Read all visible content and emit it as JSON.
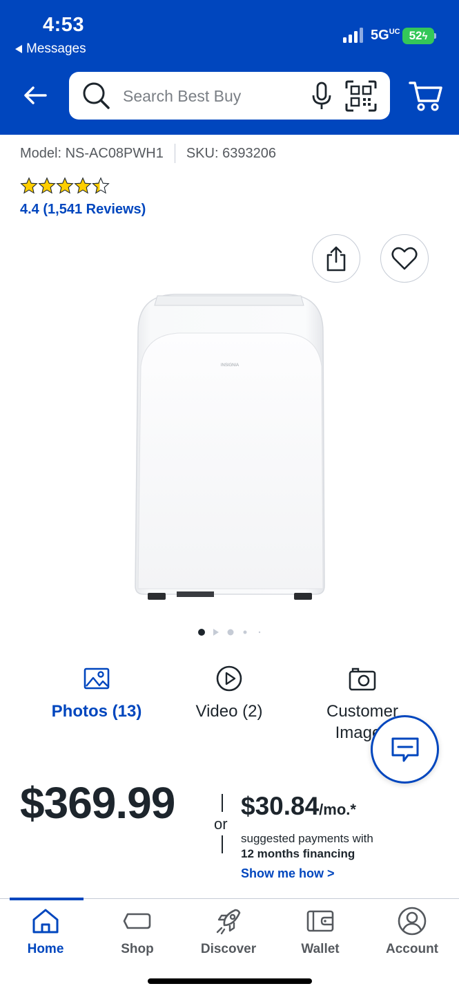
{
  "status_bar": {
    "time": "4:53",
    "back_app": "Messages",
    "network": "5G",
    "battery": "52"
  },
  "header": {
    "search_placeholder": "Search Best Buy",
    "brand_color": "#0046be"
  },
  "product": {
    "model": "Model: NS-AC08PWH1",
    "sku": "SKU: 6393206",
    "rating": 4.4,
    "rating_text": "4.4 (1,541 Reviews)",
    "image_gallery_position": "1 of 5"
  },
  "media": {
    "photos_label": "Photos (13)",
    "video_label": "Video (2)",
    "customer_label_line1": "Customer",
    "customer_label_line2": "Images"
  },
  "pricing": {
    "price": "$369.99",
    "or": "or",
    "monthly": "$30.84",
    "monthly_suffix": "/mo.*",
    "financing_line1": "suggested payments with",
    "financing_line2": "12 months financing",
    "show_me_how": "Show me how >"
  },
  "tabbar": {
    "home": "Home",
    "shop": "Shop",
    "discover": "Discover",
    "wallet": "Wallet",
    "account": "Account",
    "active": "Home"
  },
  "icons": {
    "search": "search-icon",
    "mic": "mic-icon",
    "qr": "qr-code-icon",
    "cart": "cart-icon",
    "share": "share-icon",
    "favorite": "heart-icon",
    "chat": "chat-icon"
  }
}
